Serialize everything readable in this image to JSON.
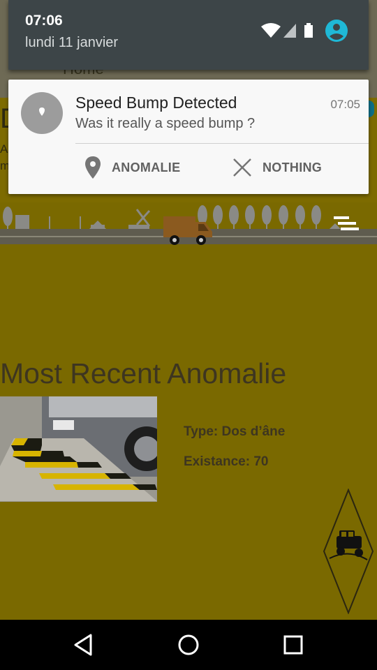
{
  "status": {
    "time": "07:06",
    "date": "lundi 11 janvier"
  },
  "notification": {
    "title": "Speed Bump Detected",
    "time": "07:05",
    "text": "Was it really a speed bump ?",
    "actions": [
      {
        "label": "ANOMALIE",
        "icon": "location-pin-icon"
      },
      {
        "label": "NOTHING",
        "icon": "close-icon"
      }
    ]
  },
  "app": {
    "nav_title": "Home",
    "section_title": "Most Recent Anomalie",
    "type_label": "Type: Dos d’âne",
    "existence_label": "Existance: 70",
    "background_color": "#7a6900",
    "text_color": "#3d3520"
  },
  "navbar": {
    "buttons": [
      "back-icon",
      "home-icon",
      "recents-icon"
    ]
  }
}
